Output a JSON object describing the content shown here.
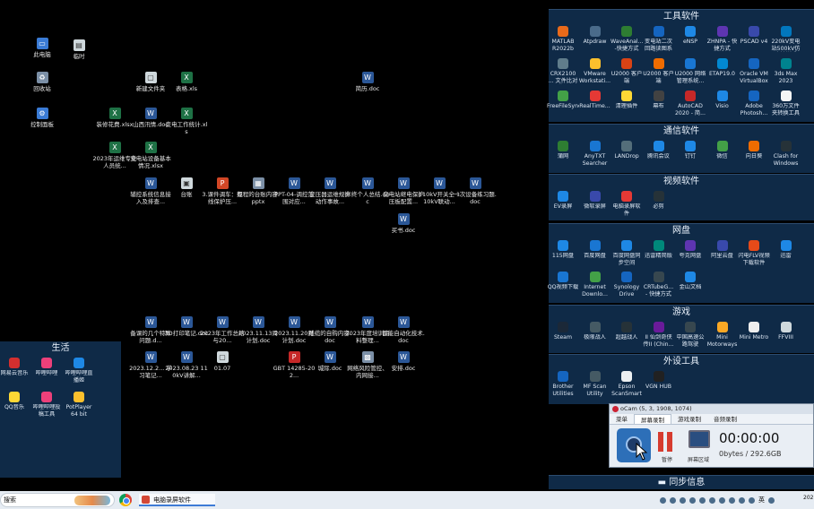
{
  "desktop": {
    "icons": [
      {
        "label": "此电脑",
        "glyph": "▭",
        "kind": "sys"
      },
      {
        "label": "临时",
        "glyph": "▤",
        "kind": "file"
      },
      {
        "label": "回收站",
        "glyph": "♻",
        "kind": "img"
      },
      {
        "label": "控制面板",
        "glyph": "⚙",
        "kind": "sys"
      },
      {
        "label": "新建文件夹",
        "glyph": "▢",
        "kind": "file"
      },
      {
        "label": "表格.xls",
        "glyph": "X",
        "kind": "excel"
      },
      {
        "label": "简历.doc",
        "glyph": "W",
        "kind": "word"
      },
      {
        "label": "装修花费.xlsx",
        "glyph": "X",
        "kind": "excel"
      },
      {
        "label": "山西汛情.doc",
        "glyph": "W",
        "kind": "word"
      },
      {
        "label": "变电工作统计.xls",
        "glyph": "X",
        "kind": "excel"
      },
      {
        "label": "2023年运维专业人员统...",
        "glyph": "X",
        "kind": "excel"
      },
      {
        "label": "变电站设备基本情况.xlsx",
        "glyph": "X",
        "kind": "excel"
      },
      {
        "label": "辅控系统信息接入及排查...",
        "glyph": "W",
        "kind": "word"
      },
      {
        "label": "台账",
        "glyph": "▣",
        "kind": "file"
      },
      {
        "label": "3.课件调车：有线保护压...",
        "glyph": "P",
        "kind": "ppt"
      },
      {
        "label": "规程的台账内容.pptx",
        "glyph": "▦",
        "kind": "img"
      },
      {
        "label": "PPT-04-调控范围对应...",
        "glyph": "W",
        "kind": "word"
      },
      {
        "label": "变压器运维规护动作事故...",
        "glyph": "W",
        "kind": "word"
      },
      {
        "label": "年终个人总结.doc",
        "glyph": "W",
        "kind": "word"
      },
      {
        "label": "变电站继电保护压板配置...",
        "glyph": "W",
        "kind": "word"
      },
      {
        "label": "110kV开关全 110kV联动...",
        "glyph": "W",
        "kind": "word"
      },
      {
        "label": "一次设备练习题.doc",
        "glyph": "W",
        "kind": "word"
      },
      {
        "label": "买书.doc",
        "glyph": "W",
        "kind": "word"
      },
      {
        "label": "备课的几个特殊问题.d...",
        "glyph": "W",
        "kind": "word"
      },
      {
        "label": "3D打印笔记.doc",
        "glyph": "W",
        "kind": "word"
      },
      {
        "label": "2023年工作总结与20...",
        "glyph": "W",
        "kind": "word"
      },
      {
        "label": "2023.11.13周计划.doc",
        "glyph": "W",
        "kind": "word"
      },
      {
        "label": "2023.11.20周计划.doc",
        "glyph": "W",
        "kind": "word"
      },
      {
        "label": "线缆的自购内容.doc",
        "glyph": "W",
        "kind": "word"
      },
      {
        "label": "2023年度培训资料整理...",
        "glyph": "W",
        "kind": "word"
      },
      {
        "label": "智能自动化技术.doc",
        "glyph": "W",
        "kind": "word"
      },
      {
        "label": "2023.12.2... 学习笔记...",
        "glyph": "W",
        "kind": "word"
      },
      {
        "label": "2023.08.23 110kV讲解...",
        "glyph": "W",
        "kind": "word"
      },
      {
        "label": "01.07",
        "glyph": "▢",
        "kind": "file"
      },
      {
        "label": "GBT 14285-202...",
        "glyph": "P",
        "kind": "pdf"
      },
      {
        "label": "城际.doc",
        "glyph": "W",
        "kind": "word"
      },
      {
        "label": "网络风险管控、内网接...",
        "glyph": "▩",
        "kind": "img"
      },
      {
        "label": "安排.doc",
        "glyph": "W",
        "kind": "word"
      }
    ]
  },
  "fences": {
    "tools": {
      "title": "工具软件",
      "items": [
        {
          "label": "MATLAB R2022b",
          "color": "#e96a1a"
        },
        {
          "label": "Atpdraw",
          "color": "#4a6b8a"
        },
        {
          "label": "WaveAnal... -快捷方式",
          "color": "#2e7d32"
        },
        {
          "label": "变电站二次回路读图系统...",
          "color": "#1565c0"
        },
        {
          "label": "eNSP",
          "color": "#1e88e5"
        },
        {
          "label": "ZHNPA - 快捷方式",
          "color": "#5e35b1"
        },
        {
          "label": "PSCAD v4",
          "color": "#3949ab"
        },
        {
          "label": "220kV变电站500kV仿真培训系统...",
          "color": "#0277bd"
        },
        {
          "label": "CRX2100 ... 文件比对分...",
          "color": "#607d8b"
        },
        {
          "label": "VMware Workstati...",
          "color": "#fbc02d"
        },
        {
          "label": "U2000 客户端",
          "color": "#d84315"
        },
        {
          "label": "U2000 客户端",
          "color": "#ef6c00"
        },
        {
          "label": "U2000 网络管理系统...",
          "color": "#1976d2"
        },
        {
          "label": "ETAP19.0",
          "color": "#0288d1"
        },
        {
          "label": "Oracle VM VirtualBox",
          "color": "#1565c0"
        },
        {
          "label": "3ds Max 2023",
          "color": "#00838f"
        },
        {
          "label": "FreeFileSync",
          "color": "#43a047"
        },
        {
          "label": "RealTime...",
          "color": "#e53935"
        },
        {
          "label": "清理插件",
          "color": "#fdd835"
        },
        {
          "label": "幕布",
          "color": "#424242"
        },
        {
          "label": "AutoCAD 2020 - 简...",
          "color": "#c62828"
        },
        {
          "label": "Visio",
          "color": "#1e88e5"
        },
        {
          "label": "Adobe Photosh...",
          "color": "#1565c0"
        },
        {
          "label": "360万文件夹转换工具",
          "color": "#f5f5f5"
        }
      ]
    },
    "comm": {
      "title": "通信软件",
      "items": [
        {
          "label": "蒲网",
          "color": "#2e7d32"
        },
        {
          "label": "AnyTXT Searcher",
          "color": "#1976d2"
        },
        {
          "label": "LANDrop",
          "color": "#546e7a"
        },
        {
          "label": "腾讯会议",
          "color": "#1e88e5"
        },
        {
          "label": "钉钉",
          "color": "#1e88e5"
        },
        {
          "label": "微信",
          "color": "#43a047"
        },
        {
          "label": "向日葵",
          "color": "#ef6c00"
        },
        {
          "label": "Clash for Windows",
          "color": "#263238"
        }
      ]
    },
    "video": {
      "title": "视频软件",
      "items": [
        {
          "label": "EV录屏",
          "color": "#1e88e5"
        },
        {
          "label": "微软录屏",
          "color": "#3949ab"
        },
        {
          "label": "电脑录屏软件",
          "color": "#e53935"
        },
        {
          "label": "必剪",
          "color": "#263238"
        }
      ]
    },
    "disk": {
      "title": "网盘",
      "items": [
        {
          "label": "115网盘",
          "color": "#1e88e5"
        },
        {
          "label": "百度网盘",
          "color": "#1976d2"
        },
        {
          "label": "百度网盘同步空间",
          "color": "#1e88e5"
        },
        {
          "label": "迅雷精简版",
          "color": "#00897b"
        },
        {
          "label": "夸克网盘",
          "color": "#5e35b1"
        },
        {
          "label": "阿里云盘",
          "color": "#3949ab"
        },
        {
          "label": "闪电FLV视频下载软件",
          "color": "#e64a19"
        },
        {
          "label": "迅雷",
          "color": "#1e88e5"
        },
        {
          "label": "QQ视频下载",
          "color": "#1976d2"
        },
        {
          "label": "Internet Downlo...",
          "color": "#43a047"
        },
        {
          "label": "Synology Drive Client",
          "color": "#1565c0"
        },
        {
          "label": "CRTubeG... - 快捷方式",
          "color": "#37474f"
        },
        {
          "label": "金山文档",
          "color": "#1e88e5"
        }
      ]
    },
    "games": {
      "title": "游戏",
      "items": [
        {
          "label": "Steam",
          "color": "#1b2838"
        },
        {
          "label": "极限战人",
          "color": "#455a64"
        },
        {
          "label": "超越战人",
          "color": "#263238"
        },
        {
          "label": "II 仙剑奇侠传II (Chin...",
          "color": "#6a1b9a"
        },
        {
          "label": "中国高速公路驾驶 (Chinese P...",
          "color": "#37474f"
        },
        {
          "label": "Mini Motorways",
          "color": "#f9a825"
        },
        {
          "label": "Mini Metro",
          "color": "#eeeeee"
        },
        {
          "label": "FFVIII",
          "color": "#cfd8dc"
        }
      ]
    },
    "peripheral": {
      "title": "外设工具",
      "items": [
        {
          "label": "Brother Utilities",
          "color": "#1565c0"
        },
        {
          "label": "MF Scan Utility",
          "color": "#455a64"
        },
        {
          "label": "Epson ScanSmart",
          "color": "#eceff1"
        },
        {
          "label": "VGN HUB",
          "color": "#212121"
        }
      ]
    },
    "sync": {
      "title": "同步信息"
    },
    "life": {
      "title": "生活",
      "items": [
        {
          "label": "网易云音乐",
          "color": "#d32f2f"
        },
        {
          "label": "哔哩哔哩",
          "color": "#ec407a"
        },
        {
          "label": "哔哩哔哩直播姬",
          "color": "#1e88e5"
        },
        {
          "label": "QQ音乐",
          "color": "#fdd835"
        },
        {
          "label": "哔哩哔哩投稿工具",
          "color": "#ec407a"
        },
        {
          "label": "PotPlayer 64 bit",
          "color": "#fbc02d"
        }
      ]
    }
  },
  "ocam": {
    "title": "oCam (5, 3, 1908, 1074)",
    "tabs": [
      "菜单",
      "屏幕录制",
      "游戏录制",
      "音频录制"
    ],
    "rec_label": "录制",
    "pause_label": "暂停",
    "screen_label": "屏幕区域",
    "time": "00:00:00",
    "size": "0bytes / 292.6GB"
  },
  "taskbar": {
    "search_text": "搜索",
    "window_label": "电脑录屏软件",
    "tray_lang": "英",
    "clock": "202"
  }
}
